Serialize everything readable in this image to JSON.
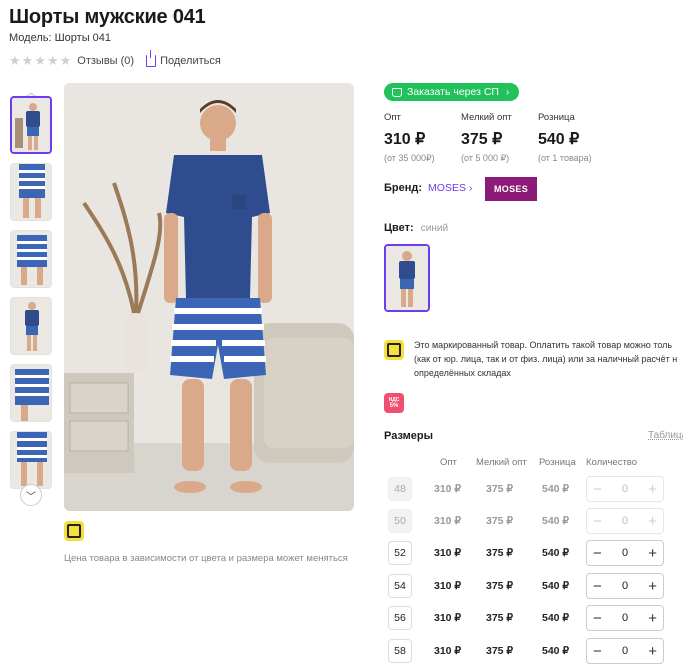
{
  "product": {
    "title": "Шорты мужские 041",
    "model": "Модель: Шорты 041",
    "reviews": "Отзывы (0)",
    "share": "Поделиться",
    "rating_stars": 0
  },
  "price_note": "Цена товара в зависимости от цвета и размера может меняться",
  "order_button": "Заказать через СП",
  "prices": [
    {
      "label": "Опт",
      "value": "310 ₽",
      "sub": "(от 35 000₽)"
    },
    {
      "label": "Мелкий опт",
      "value": "375 ₽",
      "sub": "(от 5 000 ₽)"
    },
    {
      "label": "Розница",
      "value": "540 ₽",
      "sub": "(от 1 товара)"
    }
  ],
  "brand": {
    "label": "Бренд:",
    "name": "MOSES",
    "logo_text": "MOSES"
  },
  "color": {
    "label": "Цвет:",
    "value": "синий"
  },
  "marking_text": {
    "line1": "Это маркированный товар. Оплатить такой товар можно толь",
    "line2": "(как от юр. лица, так и от физ. лица) или за наличный расчёт н",
    "line3": "определённых складах"
  },
  "nds": {
    "top": "НДС",
    "bottom": "5%"
  },
  "sizes": {
    "title": "Размеры",
    "table_link": "Таблица",
    "headers": {
      "opt": "Опт",
      "small_opt": "Мелкий опт",
      "retail": "Розница",
      "qty": "Количество"
    },
    "rows": [
      {
        "size": "48",
        "opt": "310 ₽",
        "small_opt": "375 ₽",
        "retail": "540 ₽",
        "qty": "0"
      },
      {
        "size": "50",
        "opt": "310 ₽",
        "small_opt": "375 ₽",
        "retail": "540 ₽",
        "qty": "0"
      },
      {
        "size": "52",
        "opt": "310 ₽",
        "small_opt": "375 ₽",
        "retail": "540 ₽",
        "qty": "0"
      },
      {
        "size": "54",
        "opt": "310 ₽",
        "small_opt": "375 ₽",
        "retail": "540 ₽",
        "qty": "0"
      },
      {
        "size": "56",
        "opt": "310 ₽",
        "small_opt": "375 ₽",
        "retail": "540 ₽",
        "qty": "0"
      },
      {
        "size": "58",
        "opt": "310 ₽",
        "small_opt": "375 ₽",
        "retail": "540 ₽",
        "qty": "0"
      }
    ]
  },
  "colors": {
    "accent": "#6b3cf0",
    "green": "#21c15c",
    "brand_logo": "#8c1a78",
    "marking_yellow": "#f5e03a",
    "nds_red": "#f0506e"
  }
}
